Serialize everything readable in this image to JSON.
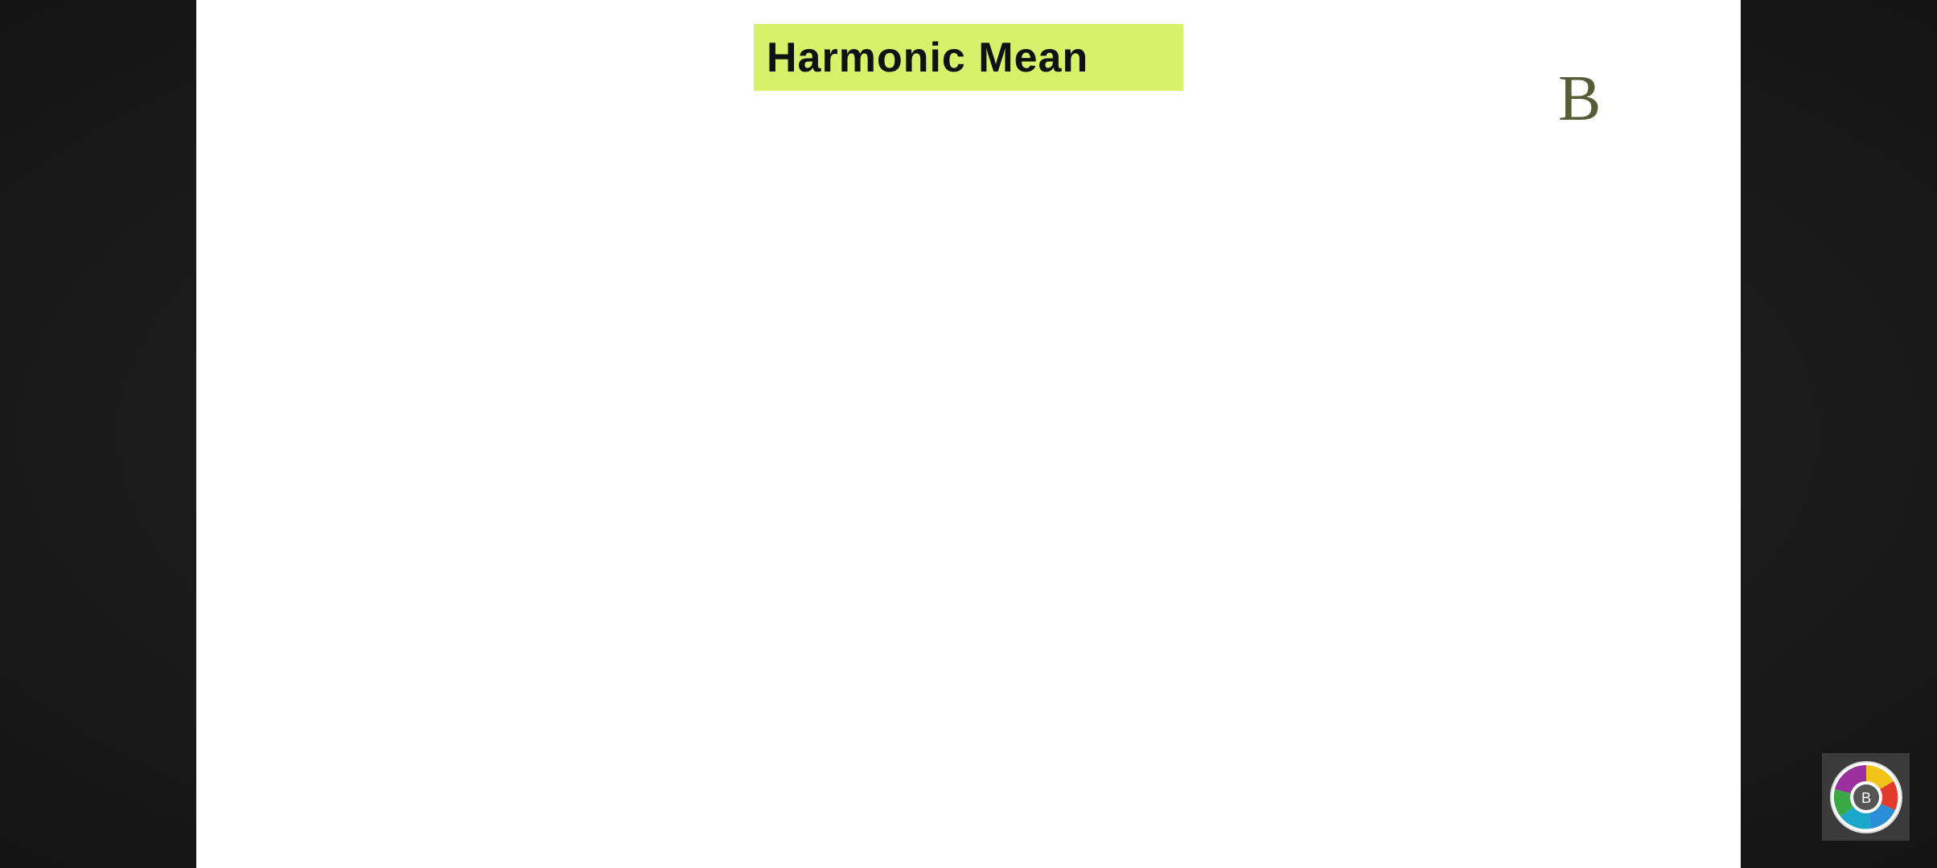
{
  "slide": {
    "title": "Harmonic Mean",
    "corner_letter": "B"
  },
  "overlay": {
    "logo_letter": "B",
    "logo_icon": "channel-logo-icon"
  },
  "colors": {
    "title_highlight": "#d8f16a",
    "corner_letter": "#555c36",
    "frame_background": "#1c1c1c",
    "slide_background": "#ffffff"
  }
}
